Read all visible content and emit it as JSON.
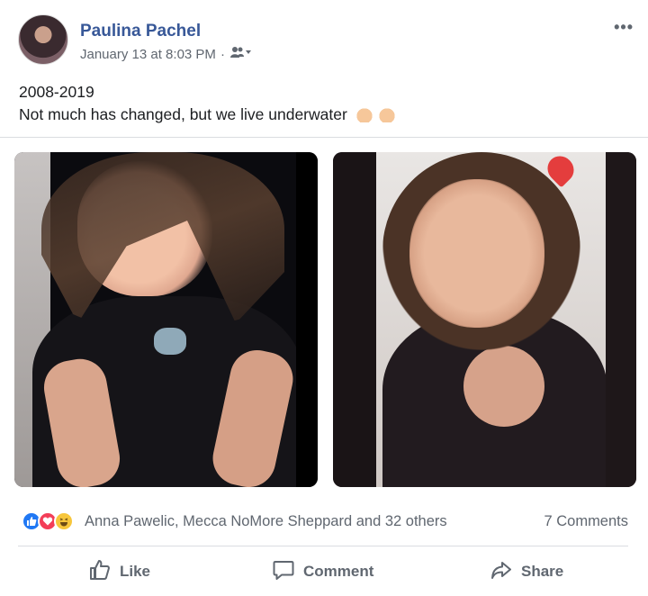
{
  "post": {
    "author": "Paulina Pachel",
    "timestamp": "January 13 at 8:03 PM",
    "separator": "·",
    "audience_icon": "friends-icon",
    "more_icon": "more-options-icon",
    "more_glyph": "•••",
    "text_line1": "2008-2019",
    "text_line2": "Not much has changed, but we live underwater",
    "emoji": [
      "raising-hands-emoji",
      "raising-hands-emoji"
    ]
  },
  "photos": [
    {
      "name": "photo-2008"
    },
    {
      "name": "photo-2019"
    }
  ],
  "reactions": {
    "icons": [
      "like-reaction-icon",
      "love-reaction-icon",
      "haha-reaction-icon"
    ],
    "names": "Anna Pawelic, Mecca NoMore Sheppard and 32 others",
    "comments": "7 Comments"
  },
  "actions": {
    "like": "Like",
    "comment": "Comment",
    "share": "Share"
  },
  "colors": {
    "link": "#385898",
    "secondary_text": "#606770",
    "like_blue": "#2078f4",
    "love_red": "#f33e58",
    "haha_yellow": "#f7c63b"
  }
}
